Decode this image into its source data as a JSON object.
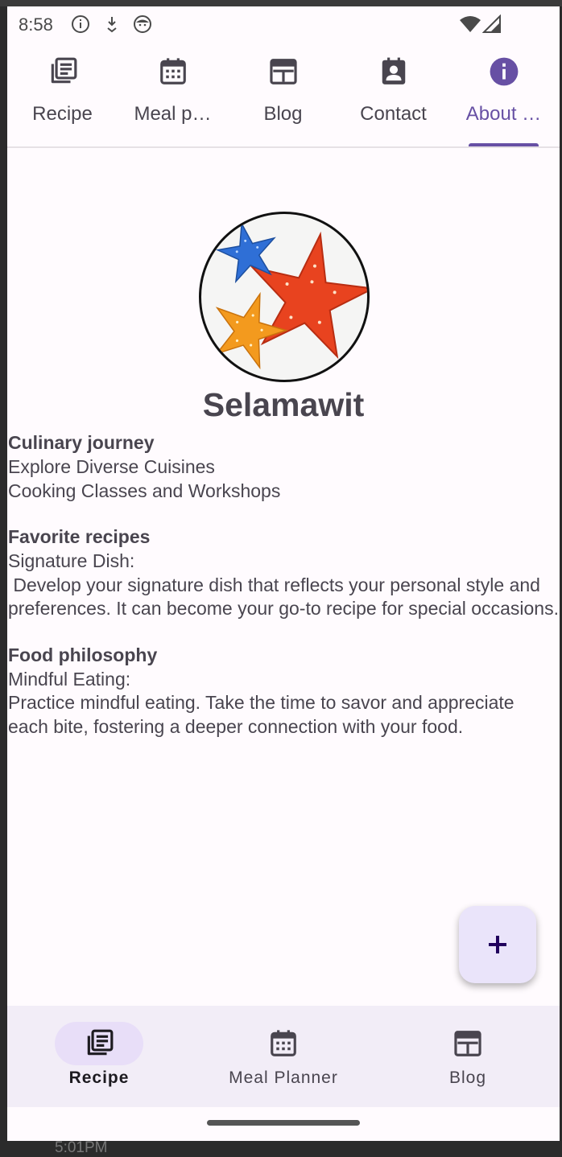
{
  "status_bar": {
    "time": "8:58"
  },
  "top_tabs": [
    {
      "label": "Recipe",
      "icon": "recipe-icon"
    },
    {
      "label": "Meal p…",
      "icon": "calendar-icon"
    },
    {
      "label": "Blog",
      "icon": "blog-icon"
    },
    {
      "label": "Contact",
      "icon": "contact-icon"
    },
    {
      "label": "About …",
      "icon": "info-icon",
      "active": true
    }
  ],
  "profile": {
    "name": "Selamawit",
    "sections": [
      {
        "heading": "Culinary journey",
        "lines": [
          "Explore Diverse Cuisines",
          "Cooking Classes and Workshops"
        ]
      },
      {
        "heading": "Favorite recipes",
        "lines": [
          "Signature Dish:",
          " Develop your signature dish that reflects your personal style and preferences. It can become your go-to recipe for special occasions."
        ]
      },
      {
        "heading": "Food philosophy",
        "lines": [
          "Mindful Eating:",
          "Practice mindful eating. Take the time to savor and appreciate each bite, fostering a deeper connection with your food."
        ]
      }
    ]
  },
  "fab": {
    "icon": "plus-icon"
  },
  "bottom_nav": [
    {
      "label": "Recipe",
      "icon": "recipe-icon",
      "active": true
    },
    {
      "label": "Meal Planner",
      "icon": "calendar-icon"
    },
    {
      "label": "Blog",
      "icon": "blog-icon"
    }
  ],
  "background_text": "5:01PM",
  "colors": {
    "accent": "#6750a4",
    "text": "#49454f",
    "surface": "#fffbfe",
    "nav_bg": "#f2edf7",
    "pill": "#e8def8",
    "fab_bg": "#eae4fa"
  }
}
